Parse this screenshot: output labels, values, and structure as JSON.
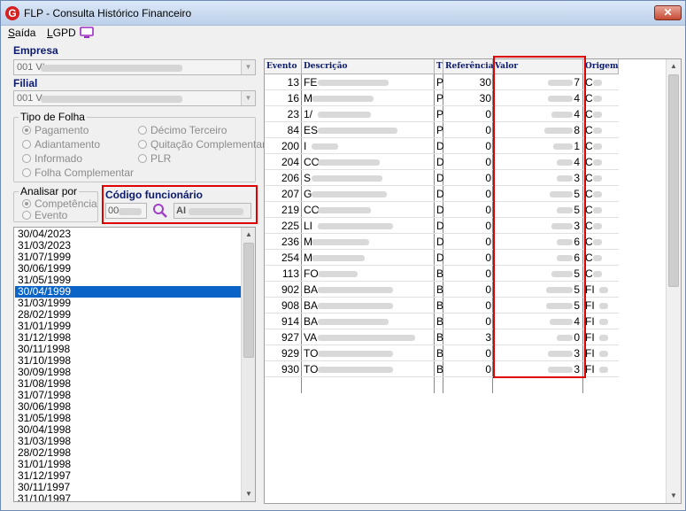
{
  "window": {
    "title": "FLP - Consulta Histórico Financeiro",
    "logo_letter": "G",
    "close_label": "✕"
  },
  "menu": {
    "saida": "Saída",
    "lgpd": "LGPD"
  },
  "empresa": {
    "label": "Empresa",
    "value": "001 VI"
  },
  "filial": {
    "label": "Filial",
    "value": "001 V"
  },
  "tipo_folha": {
    "title": "Tipo de Folha",
    "options": [
      "Pagamento",
      "Décimo Terceiro",
      "Adiantamento",
      "Quitação Complementar",
      "Informado",
      "PLR",
      "Folha Complementar"
    ],
    "selected": "Pagamento"
  },
  "analisar": {
    "title": "Analisar por",
    "options": [
      "Competência",
      "Evento"
    ],
    "selected": "Competência"
  },
  "codigo": {
    "label": "Código funcionário",
    "value": "00",
    "name_prefix": "AI"
  },
  "dates": [
    "30/04/2023",
    "31/03/2023",
    "31/07/1999",
    "30/06/1999",
    "31/05/1999",
    "30/04/1999",
    "31/03/1999",
    "28/02/1999",
    "31/01/1999",
    "31/12/1998",
    "30/11/1998",
    "31/10/1998",
    "30/09/1998",
    "31/08/1998",
    "31/07/1998",
    "30/06/1998",
    "31/05/1998",
    "30/04/1998",
    "31/03/1998",
    "28/02/1998",
    "31/01/1998",
    "31/12/1997",
    "30/11/1997",
    "31/10/1997"
  ],
  "selected_date": "30/04/1999",
  "grid": {
    "columns": [
      "Evento",
      "Descrição",
      "T",
      "Referência",
      "Valor",
      "Origem"
    ],
    "rows": [
      {
        "evento": "13",
        "desc": "FE",
        "tipo": "P",
        "ref": "30",
        "val": "7",
        "orig": "C"
      },
      {
        "evento": "16",
        "desc": "M",
        "tipo": "P",
        "ref": "30",
        "val": "4",
        "orig": "C"
      },
      {
        "evento": "23",
        "desc": "1/",
        "tipo": "P",
        "ref": "0",
        "val": "4",
        "orig": "C"
      },
      {
        "evento": "84",
        "desc": "ES",
        "tipo": "P",
        "ref": "0",
        "val": "8",
        "orig": "C"
      },
      {
        "evento": "200",
        "desc": "I",
        "tipo": "D",
        "ref": "0",
        "val": "1",
        "orig": "C"
      },
      {
        "evento": "204",
        "desc": "CO",
        "tipo": "D",
        "ref": "0",
        "val": "4",
        "orig": "C"
      },
      {
        "evento": "206",
        "desc": "S",
        "tipo": "D",
        "ref": "0",
        "val": "3",
        "orig": "C"
      },
      {
        "evento": "207",
        "desc": "G",
        "tipo": "D",
        "ref": "0",
        "val": "5",
        "orig": "C"
      },
      {
        "evento": "219",
        "desc": "CO",
        "tipo": "D",
        "ref": "0",
        "val": "5",
        "orig": "C"
      },
      {
        "evento": "225",
        "desc": "LI",
        "tipo": "D",
        "ref": "0",
        "val": "3",
        "orig": "C"
      },
      {
        "evento": "236",
        "desc": "M",
        "tipo": "D",
        "ref": "0",
        "val": "6",
        "orig": "C"
      },
      {
        "evento": "254",
        "desc": "M",
        "tipo": "D",
        "ref": "0",
        "val": "6",
        "orig": "C"
      },
      {
        "evento": "113",
        "desc": "FO",
        "tipo": "B",
        "ref": "0",
        "val": "5",
        "orig": "C"
      },
      {
        "evento": "902",
        "desc": "BA",
        "tipo": "B",
        "ref": "0",
        "val": "5",
        "orig": "FI"
      },
      {
        "evento": "908",
        "desc": "BA",
        "tipo": "B",
        "ref": "0",
        "val": "5",
        "orig": "FI"
      },
      {
        "evento": "914",
        "desc": "BA",
        "tipo": "B",
        "ref": "0",
        "val": "4",
        "orig": "FI"
      },
      {
        "evento": "927",
        "desc": "VA",
        "tipo": "B",
        "ref": "3",
        "val": "0",
        "orig": "FI"
      },
      {
        "evento": "929",
        "desc": "TO",
        "tipo": "B",
        "ref": "0",
        "val": "3",
        "orig": "FI"
      },
      {
        "evento": "930",
        "desc": "TO",
        "tipo": "B",
        "ref": "0",
        "val": "3",
        "orig": "FI"
      }
    ]
  },
  "colors": {
    "accent_red": "#e00000",
    "selection_blue": "#0a64c8",
    "label_navy": "#0a1a6e"
  },
  "icons": [
    "app-logo-icon",
    "close-icon",
    "monitor-icon",
    "magnifier-icon",
    "chevron-down-icon",
    "scroll-up-icon",
    "scroll-down-icon"
  ]
}
